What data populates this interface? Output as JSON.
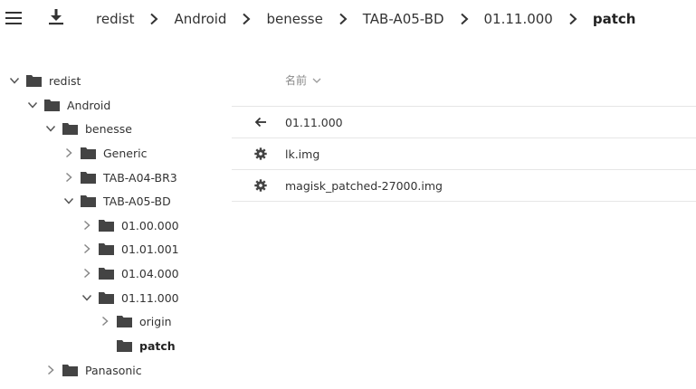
{
  "toolbar": {
    "menu_icon": "hamburger-menu-icon",
    "download_icon": "download-icon"
  },
  "breadcrumb": [
    {
      "label": "redist"
    },
    {
      "label": "Android"
    },
    {
      "label": "benesse"
    },
    {
      "label": "TAB-A05-BD"
    },
    {
      "label": "01.11.000"
    },
    {
      "label": "patch"
    }
  ],
  "tree": [
    {
      "label": "redist",
      "expanded": true
    },
    {
      "label": "Android",
      "expanded": true
    },
    {
      "label": "benesse",
      "expanded": true
    },
    {
      "label": "Generic",
      "expanded": false
    },
    {
      "label": "TAB-A04-BR3",
      "expanded": false
    },
    {
      "label": "TAB-A05-BD",
      "expanded": true
    },
    {
      "label": "01.00.000",
      "expanded": false
    },
    {
      "label": "01.01.001",
      "expanded": false
    },
    {
      "label": "01.04.000",
      "expanded": false
    },
    {
      "label": "01.11.000",
      "expanded": true
    },
    {
      "label": "origin",
      "expanded": false
    },
    {
      "label": "patch",
      "selected": true
    },
    {
      "label": "Panasonic",
      "expanded": false
    }
  ],
  "list": {
    "header": {
      "name_label": "名前"
    },
    "rows": [
      {
        "icon": "back-arrow-icon",
        "name": "01.11.000"
      },
      {
        "icon": "gear-icon",
        "name": "lk.img"
      },
      {
        "icon": "gear-icon",
        "name": "magisk_patched-27000.img"
      }
    ]
  }
}
